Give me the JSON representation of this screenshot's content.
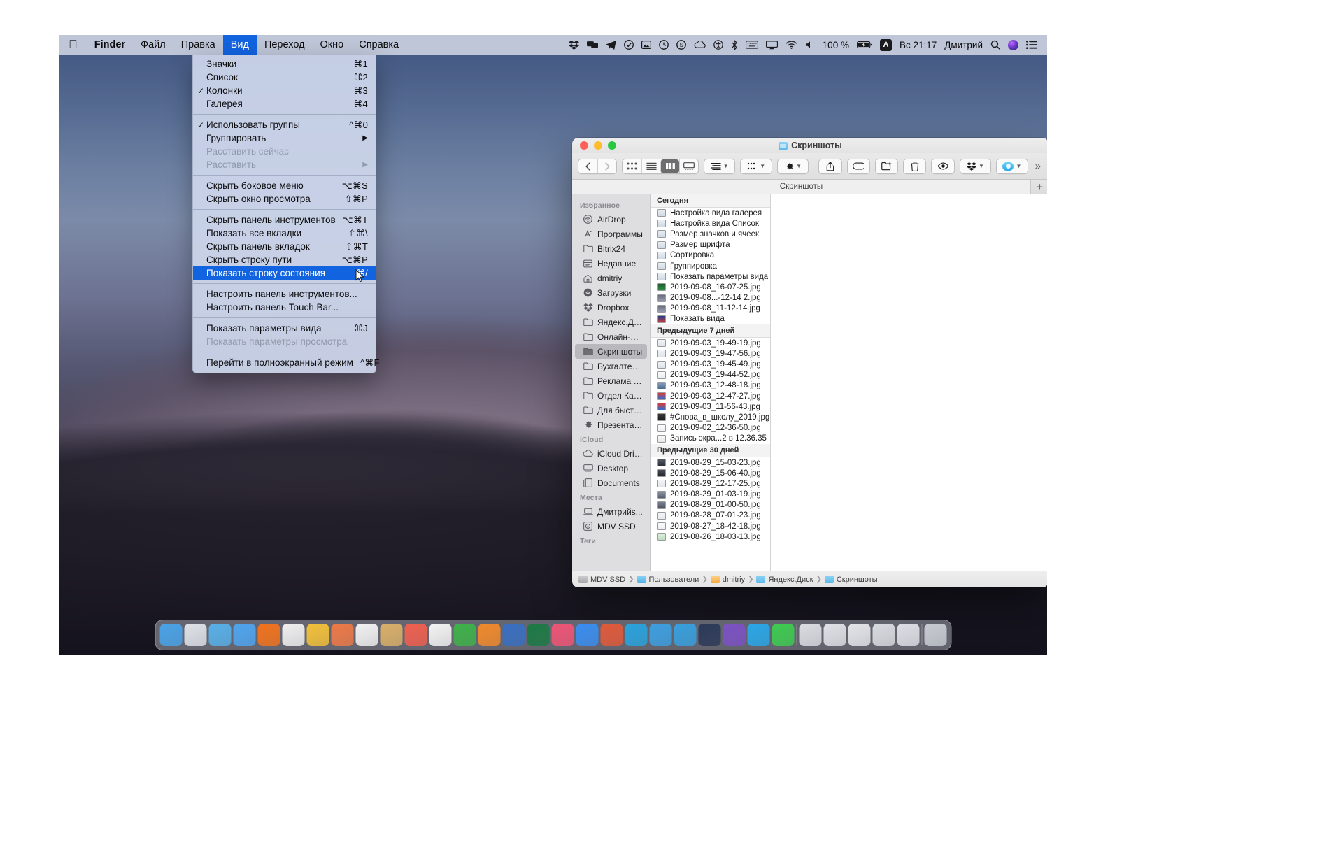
{
  "menubar": {
    "apple_icon": "apple-logo-icon",
    "items": [
      {
        "label": "Finder",
        "bold": true,
        "active": false
      },
      {
        "label": "Файл",
        "bold": false,
        "active": false
      },
      {
        "label": "Правка",
        "bold": false,
        "active": false
      },
      {
        "label": "Вид",
        "bold": false,
        "active": true
      },
      {
        "label": "Переход",
        "bold": false,
        "active": false
      },
      {
        "label": "Окно",
        "bold": false,
        "active": false
      },
      {
        "label": "Справка",
        "bold": false,
        "active": false
      }
    ],
    "status": {
      "battery_percent": "100 %",
      "input_source": "A",
      "clock": "Вс 21:17",
      "user": "Дмитрий",
      "icons": [
        "dropbox-icon",
        "screens-icon",
        "telegram-icon",
        "checkmark-circle-icon",
        "photos-icon",
        "clock-badge-icon",
        "skype-icon",
        "cloud-sync-icon",
        "accessibility-icon",
        "bluetooth-icon",
        "keyboard-icon",
        "airplay-icon",
        "wifi-icon",
        "volume-icon",
        "battery-icon",
        "spotlight-search-icon",
        "siri-icon",
        "control-center-icon"
      ]
    }
  },
  "view_menu": {
    "title": "Вид",
    "groups": [
      {
        "items": [
          {
            "label": "Значки",
            "shortcut": "⌘1",
            "checked": false,
            "disabled": false,
            "selected": false,
            "submenu": false
          },
          {
            "label": "Список",
            "shortcut": "⌘2",
            "checked": false,
            "disabled": false,
            "selected": false,
            "submenu": false
          },
          {
            "label": "Колонки",
            "shortcut": "⌘3",
            "checked": true,
            "disabled": false,
            "selected": false,
            "submenu": false
          },
          {
            "label": "Галерея",
            "shortcut": "⌘4",
            "checked": false,
            "disabled": false,
            "selected": false,
            "submenu": false
          }
        ]
      },
      {
        "items": [
          {
            "label": "Использовать группы",
            "shortcut": "^⌘0",
            "checked": true,
            "disabled": false,
            "selected": false,
            "submenu": false
          },
          {
            "label": "Группировать",
            "shortcut": "",
            "checked": false,
            "disabled": false,
            "selected": false,
            "submenu": true
          },
          {
            "label": "Расставить сейчас",
            "shortcut": "",
            "checked": false,
            "disabled": true,
            "selected": false,
            "submenu": false
          },
          {
            "label": "Расставить",
            "shortcut": "",
            "checked": false,
            "disabled": true,
            "selected": false,
            "submenu": true
          }
        ]
      },
      {
        "items": [
          {
            "label": "Скрыть боковое меню",
            "shortcut": "⌥⌘S",
            "checked": false,
            "disabled": false,
            "selected": false,
            "submenu": false
          },
          {
            "label": "Скрыть окно просмотра",
            "shortcut": "⇧⌘P",
            "checked": false,
            "disabled": false,
            "selected": false,
            "submenu": false
          }
        ]
      },
      {
        "items": [
          {
            "label": "Скрыть панель инструментов",
            "shortcut": "⌥⌘T",
            "checked": false,
            "disabled": false,
            "selected": false,
            "submenu": false
          },
          {
            "label": "Показать все вкладки",
            "shortcut": "⇧⌘\\",
            "checked": false,
            "disabled": false,
            "selected": false,
            "submenu": false
          },
          {
            "label": "Скрыть панель вкладок",
            "shortcut": "⇧⌘T",
            "checked": false,
            "disabled": false,
            "selected": false,
            "submenu": false
          },
          {
            "label": "Скрыть строку пути",
            "shortcut": "⌥⌘P",
            "checked": false,
            "disabled": false,
            "selected": false,
            "submenu": false
          },
          {
            "label": "Показать строку состояния",
            "shortcut": "⌘/",
            "checked": false,
            "disabled": false,
            "selected": true,
            "submenu": false
          }
        ]
      },
      {
        "items": [
          {
            "label": "Настроить панель инструментов...",
            "shortcut": "",
            "checked": false,
            "disabled": false,
            "selected": false,
            "submenu": false
          },
          {
            "label": "Настроить панель Touch Bar...",
            "shortcut": "",
            "checked": false,
            "disabled": false,
            "selected": false,
            "submenu": false
          }
        ]
      },
      {
        "items": [
          {
            "label": "Показать параметры вида",
            "shortcut": "⌘J",
            "checked": false,
            "disabled": false,
            "selected": false,
            "submenu": false
          },
          {
            "label": "Показать параметры просмотра",
            "shortcut": "",
            "checked": false,
            "disabled": true,
            "selected": false,
            "submenu": false
          }
        ]
      },
      {
        "items": [
          {
            "label": "Перейти в полноэкранный режим",
            "shortcut": "^⌘F",
            "checked": false,
            "disabled": false,
            "selected": false,
            "submenu": false
          }
        ]
      }
    ]
  },
  "finder": {
    "window_title": "Скриншоты",
    "tab_label": "Скриншоты",
    "new_tab_label": "+",
    "overflow_label": "»",
    "toolbar": {
      "back_label": "‹",
      "forward_label": "›",
      "view_icons_label": "icon-view-icon",
      "view_list_label": "list-view-icon",
      "view_columns_label": "column-view-icon",
      "view_gallery_label": "gallery-view-icon",
      "group_label": "group-by-icon",
      "arrange_label": "arrange-icon",
      "action_label": "gear-icon",
      "share_label": "share-icon",
      "tag_label": "tag-icon",
      "newfolder_label": "new-folder-icon",
      "delete_label": "trash-icon",
      "quicklook_label": "eye-icon",
      "dropbox_label": "dropbox-icon",
      "icloud_label": "icloud-icon"
    },
    "sidebar": {
      "sections": [
        {
          "title": "Избранное",
          "items": [
            {
              "label": "AirDrop",
              "icon": "airdrop-icon",
              "selected": false
            },
            {
              "label": "Программы",
              "icon": "apps-icon",
              "selected": false
            },
            {
              "label": "Bitrix24",
              "icon": "folder-icon",
              "selected": false
            },
            {
              "label": "Недавние",
              "icon": "recents-icon",
              "selected": false
            },
            {
              "label": "dmitriy",
              "icon": "home-icon",
              "selected": false
            },
            {
              "label": "Загрузки",
              "icon": "downloads-icon",
              "selected": false
            },
            {
              "label": "Dropbox",
              "icon": "dropbox-icon",
              "selected": false
            },
            {
              "label": "Яндекс.Диск",
              "icon": "folder-icon",
              "selected": false
            },
            {
              "label": "Онлайн-шк...",
              "icon": "folder-icon",
              "selected": false
            },
            {
              "label": "Скриншоты",
              "icon": "folder-icon",
              "selected": true
            },
            {
              "label": "Бухгалтерия",
              "icon": "folder-icon",
              "selected": false
            },
            {
              "label": "Реклама ма...",
              "icon": "folder-icon",
              "selected": false
            },
            {
              "label": "Отдел Кадр...",
              "icon": "folder-icon",
              "selected": false
            },
            {
              "label": "Для быстро...",
              "icon": "folder-icon",
              "selected": false
            },
            {
              "label": "Презентаци...",
              "icon": "gear-icon",
              "selected": false
            }
          ]
        },
        {
          "title": "iCloud",
          "items": [
            {
              "label": "iCloud Drive",
              "icon": "cloud-icon",
              "selected": false
            },
            {
              "label": "Desktop",
              "icon": "desktop-icon",
              "selected": false
            },
            {
              "label": "Documents",
              "icon": "documents-icon",
              "selected": false
            }
          ]
        },
        {
          "title": "Места",
          "items": [
            {
              "label": "Дмитрийs...",
              "icon": "laptop-icon",
              "selected": false
            },
            {
              "label": "MDV SSD",
              "icon": "disk-icon",
              "selected": false
            }
          ]
        },
        {
          "title": "Теги",
          "items": []
        }
      ]
    },
    "file_list": {
      "groups": [
        {
          "title": "Сегодня",
          "files": [
            {
              "name": "Настройка вида галерея",
              "icon": "image-file-icon"
            },
            {
              "name": "Настройка вида Список",
              "icon": "image-file-icon"
            },
            {
              "name": "Размер значков и ячеек",
              "icon": "image-file-icon"
            },
            {
              "name": "Размер шрифта",
              "icon": "image-file-icon"
            },
            {
              "name": "Сортировка",
              "icon": "image-file-icon"
            },
            {
              "name": "Группировка",
              "icon": "image-file-icon"
            },
            {
              "name": "Показать параметры вида",
              "icon": "image-file-icon"
            },
            {
              "name": "2019-09-08_16-07-25.jpg",
              "icon": "image-file-icon"
            },
            {
              "name": "2019-09-08...-12-14 2.jpg",
              "icon": "image-file-icon"
            },
            {
              "name": "2019-09-08_11-12-14.jpg",
              "icon": "image-file-icon"
            },
            {
              "name": "Показать  вида",
              "icon": "image-file-icon"
            }
          ]
        },
        {
          "title": "Предыдущие 7 дней",
          "files": [
            {
              "name": "2019-09-03_19-49-19.jpg",
              "icon": "image-file-icon"
            },
            {
              "name": "2019-09-03_19-47-56.jpg",
              "icon": "image-file-icon"
            },
            {
              "name": "2019-09-03_19-45-49.jpg",
              "icon": "image-file-icon"
            },
            {
              "name": "2019-09-03_19-44-52.jpg",
              "icon": "image-file-icon"
            },
            {
              "name": "2019-09-03_12-48-18.jpg",
              "icon": "image-file-icon"
            },
            {
              "name": "2019-09-03_12-47-27.jpg",
              "icon": "image-file-icon"
            },
            {
              "name": "2019-09-03_11-56-43.jpg",
              "icon": "image-file-icon"
            },
            {
              "name": "#Снова_в_школу_2019.jpg",
              "icon": "image-file-icon"
            },
            {
              "name": "2019-09-02_12-36-50.jpg",
              "icon": "image-file-icon"
            },
            {
              "name": "Запись экра...2 в 12.36.35",
              "icon": "movie-file-icon"
            }
          ]
        },
        {
          "title": "Предыдущие 30 дней",
          "files": [
            {
              "name": "2019-08-29_15-03-23.jpg",
              "icon": "image-file-icon"
            },
            {
              "name": "2019-08-29_15-06-40.jpg",
              "icon": "image-file-icon"
            },
            {
              "name": "2019-08-29_12-17-25.jpg",
              "icon": "image-file-icon"
            },
            {
              "name": "2019-08-29_01-03-19.jpg",
              "icon": "image-file-icon"
            },
            {
              "name": "2019-08-29_01-00-50.jpg",
              "icon": "image-file-icon"
            },
            {
              "name": "2019-08-28_07-01-23.jpg",
              "icon": "image-file-icon"
            },
            {
              "name": "2019-08-27_18-42-18.jpg",
              "icon": "image-file-icon"
            },
            {
              "name": "2019-08-26_18-03-13.jpg",
              "icon": "image-file-icon"
            }
          ]
        }
      ]
    },
    "path_bar": [
      {
        "label": "MDV SSD",
        "icon": "disk-icon"
      },
      {
        "label": "Пользователи",
        "icon": "users-folder-icon"
      },
      {
        "label": "dmitriy",
        "icon": "home-icon"
      },
      {
        "label": "Яндекс.Диск",
        "icon": "folder-icon"
      },
      {
        "label": "Скриншоты",
        "icon": "folder-icon"
      }
    ]
  },
  "dock": {
    "items": [
      {
        "name": "finder-icon",
        "color": "#4aa3e8"
      },
      {
        "name": "launchpad-icon",
        "color": "#dfe3e8"
      },
      {
        "name": "safari-icon",
        "color": "#58b0e8"
      },
      {
        "name": "mail-icon",
        "color": "#4fa5ef"
      },
      {
        "name": "firefox-icon",
        "color": "#f2731d"
      },
      {
        "name": "chrome-icon",
        "color": "#f0f0f0"
      },
      {
        "name": "notes-icon",
        "color": "#f3c13a"
      },
      {
        "name": "reminders-icon",
        "color": "#ee7a48"
      },
      {
        "name": "calendar-icon",
        "color": "#f2f2f2"
      },
      {
        "name": "contacts-icon",
        "color": "#d9b06a"
      },
      {
        "name": "books-icon",
        "color": "#f06050"
      },
      {
        "name": "photos-icon",
        "color": "#f4f4f4"
      },
      {
        "name": "numbers-icon",
        "color": "#3fb24a"
      },
      {
        "name": "pages-icon",
        "color": "#f28a2c"
      },
      {
        "name": "keynote-icon",
        "color": "#3a6fc0"
      },
      {
        "name": "excel-icon",
        "color": "#1d7a45"
      },
      {
        "name": "itunes-icon",
        "color": "#ef5576"
      },
      {
        "name": "appstore-icon",
        "color": "#3a8ef0"
      },
      {
        "name": "xcode-icon",
        "color": "#e05a3b"
      },
      {
        "name": "bitrix24-icon",
        "color": "#2aa3dd"
      },
      {
        "name": "tweetbot-icon",
        "color": "#3e9fe0"
      },
      {
        "name": "telegram-icon",
        "color": "#38a0dd"
      },
      {
        "name": "screens-icon",
        "color": "#2c3a58"
      },
      {
        "name": "viber-icon",
        "color": "#7c52c3"
      },
      {
        "name": "skype-icon",
        "color": "#2aa7e8"
      },
      {
        "name": "whatsapp-icon",
        "color": "#3fcb51"
      },
      {
        "name": "preview-icon",
        "color": "#dadde2"
      },
      {
        "name": "documents-stack-icon",
        "color": "#dfe2e6"
      },
      {
        "name": "screenshots-stack-icon",
        "color": "#e4e6ea"
      },
      {
        "name": "downloads-stack-icon",
        "color": "#d9dce1"
      },
      {
        "name": "folder-stack-icon",
        "color": "#dde0e5"
      },
      {
        "name": "trash-icon",
        "color": "#c8ccd2"
      }
    ]
  }
}
